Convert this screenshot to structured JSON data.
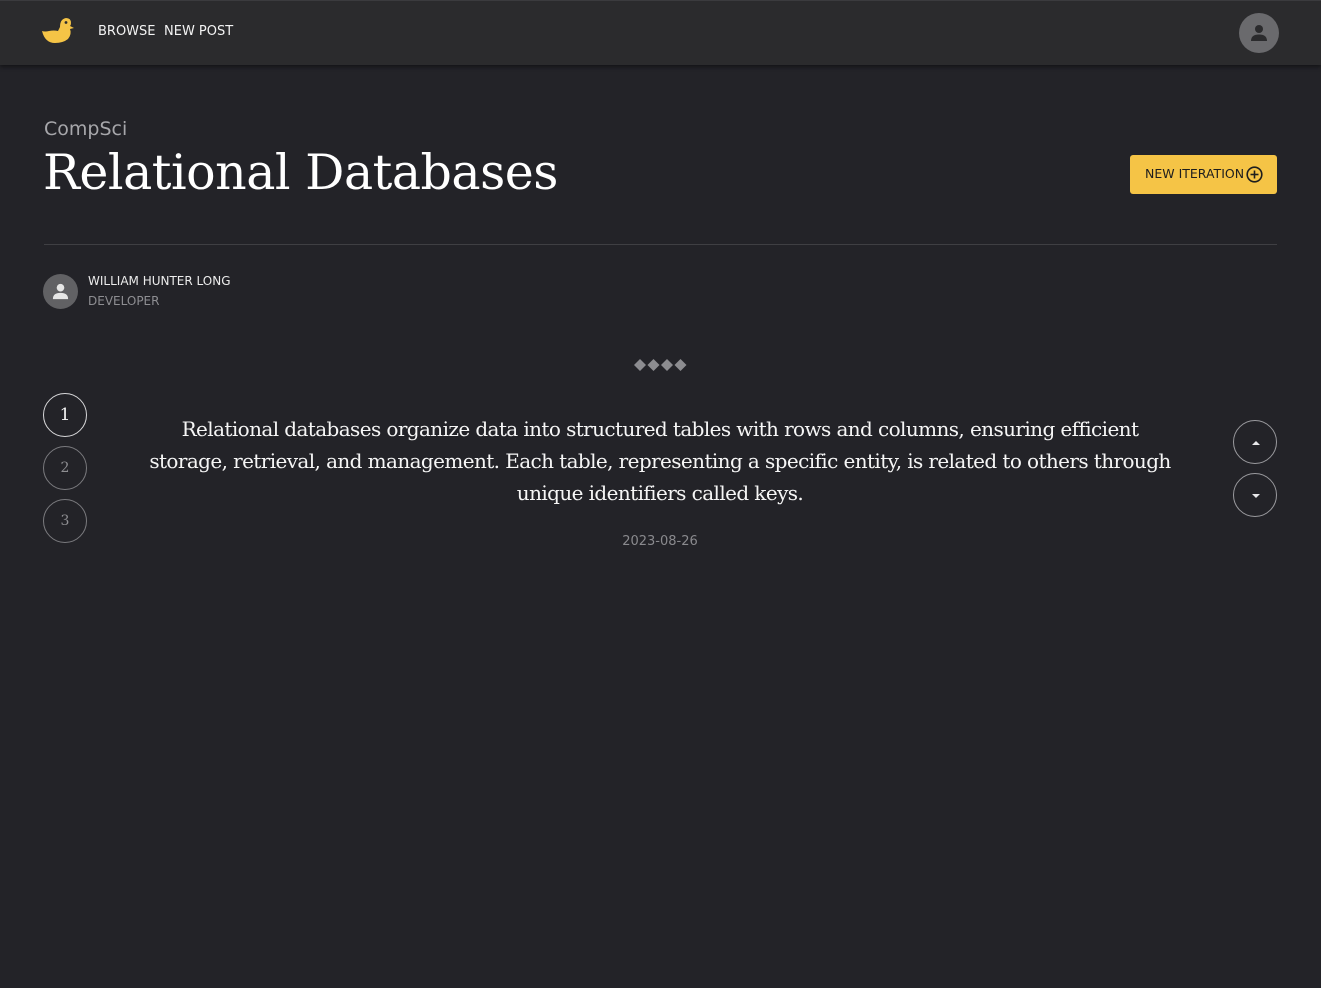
{
  "colors": {
    "background": "#232328",
    "topbar": "#2b2b2d",
    "accent": "#f5c446",
    "text": "#f1f1f1",
    "muted": "#8e8e92"
  },
  "nav": {
    "logo_icon": "duck-logo-icon",
    "browse_label": "BROWSE",
    "new_post_label": "NEW POST",
    "account_icon": "account-icon"
  },
  "post": {
    "category": "CompSci",
    "title": "Relational Databases",
    "new_iteration_label": "NEW ITERATION",
    "new_iteration_icon": "plus-circle-icon",
    "author": {
      "name": "WILLIAM HUNTER LONG",
      "role": "DEVELOPER",
      "avatar_icon": "person-icon"
    },
    "ornament_icon": "diamond-ornament-icon",
    "iterations": [
      "1",
      "2",
      "3"
    ],
    "active_iteration": "1",
    "body": "Relational databases organize data into structured tables with rows and columns, ensuring efficient storage, retrieval, and management. Each table, representing a specific entity, is related to others through unique identifiers called keys.",
    "date": "2023-08-26",
    "upvote_icon": "caret-up-icon",
    "downvote_icon": "caret-down-icon"
  }
}
